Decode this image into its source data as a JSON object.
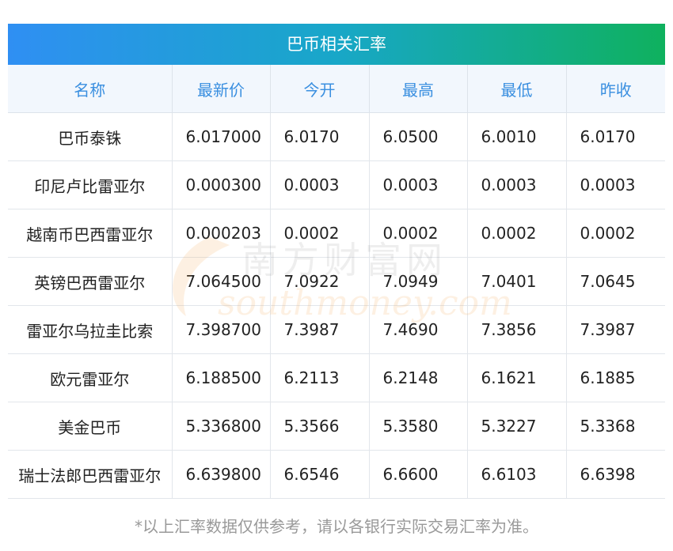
{
  "title": "巴币相关汇率",
  "columns": [
    "名称",
    "最新价",
    "今开",
    "最高",
    "最低",
    "昨收"
  ],
  "rows": [
    [
      "巴币泰铢",
      "6.017000",
      "6.0170",
      "6.0500",
      "6.0010",
      "6.0170"
    ],
    [
      "印尼卢比雷亚尔",
      "0.000300",
      "0.0003",
      "0.0003",
      "0.0003",
      "0.0003"
    ],
    [
      "越南币巴西雷亚尔",
      "0.000203",
      "0.0002",
      "0.0002",
      "0.0002",
      "0.0002"
    ],
    [
      "英镑巴西雷亚尔",
      "7.064500",
      "7.0922",
      "7.0949",
      "7.0401",
      "7.0645"
    ],
    [
      "雷亚尔乌拉圭比索",
      "7.398700",
      "7.3987",
      "7.4690",
      "7.3856",
      "7.3987"
    ],
    [
      "欧元雷亚尔",
      "6.188500",
      "6.2113",
      "6.2148",
      "6.1621",
      "6.1885"
    ],
    [
      "美金巴币",
      "5.336800",
      "5.3566",
      "5.3580",
      "5.3227",
      "5.3368"
    ],
    [
      "瑞士法郎巴西雷亚尔",
      "6.639800",
      "6.6546",
      "6.6600",
      "6.6103",
      "6.6398"
    ]
  ],
  "footnote": "*以上汇率数据仅供参考，请以各银行实际交易汇率为准。",
  "watermark": {
    "cn": "南方财富网",
    "en": "southmoney.com"
  },
  "colors": {
    "header_text": "#3a8fe0",
    "gradient_start": "#2f8ff3",
    "gradient_end": "#0fb15e",
    "watermark": "#f39c38"
  }
}
